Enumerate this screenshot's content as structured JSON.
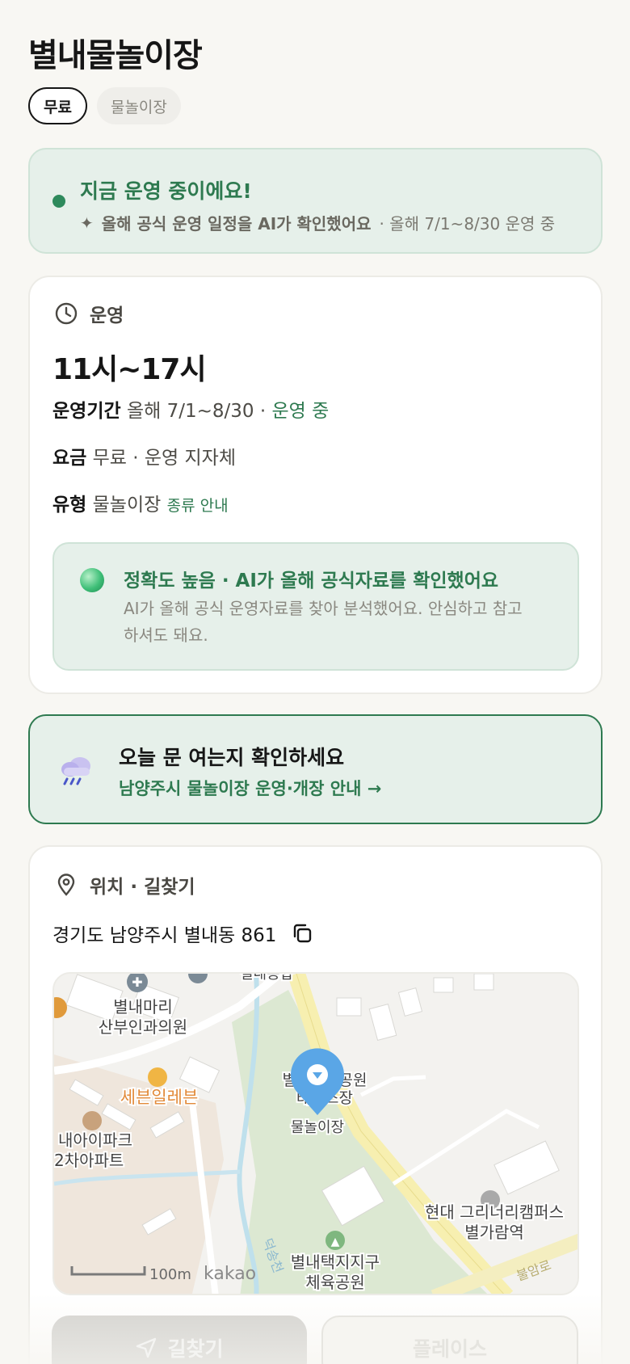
{
  "page": {
    "title": "별내물놀이장",
    "chips": [
      "무료",
      "물놀이장"
    ]
  },
  "status": {
    "title": "지금 운영 중이에요!",
    "sub_bold": "올해 공식 운영 일정을 AI가 확인했어요",
    "sub_rest": "· 올해 7/1~8/30 운영 중",
    "icon": "sparkle-icon"
  },
  "operation": {
    "heading": "운영",
    "hours": "11시~17시",
    "period_label": "운영기간",
    "period_value": "올해 7/1~8/30 ·",
    "period_status": "운영 중",
    "fee_label": "요금",
    "fee_value": "무료 · 운영 지자체",
    "type_label": "유형",
    "type_value": "물놀이장",
    "type_link": "종류 안내",
    "accuracy_title": "정확도 높음 · AI가 올해 공식자료를 확인했어요",
    "accuracy_desc": "AI가 올해 공식 운영자료를 찾아 분석했어요. 안심하고 참고하셔도 돼요."
  },
  "notice": {
    "title": "오늘 문 여는지 확인하세요",
    "link": "남양주시 물놀이장 운영·개장 안내 →",
    "icon": "rain-cloud-icon"
  },
  "location": {
    "heading": "위치 · 길찾기",
    "address": "경기도 남양주시 별내동 861",
    "map": {
      "labels": {
        "clinic": "별내마리\n산부인과의원",
        "store": "세븐일레븐",
        "apartment": "내아이파크\n2차아파트",
        "park": "별내근린공원\n테니스장",
        "pin": "물놀이장",
        "campus": "현대 그리너리캠퍼스\n별가람역",
        "sports": "별내택지지구\n체육공원",
        "stream": "덕송천",
        "road": "불암로",
        "top": "별내종합"
      },
      "scale": "100m",
      "brand": "kakao"
    }
  },
  "actions": {
    "directions": "길찾기",
    "place": "플레이스"
  },
  "colors": {
    "accent": "#2e7a50",
    "background": "#f8f7f3",
    "status_bg": "#e6f0ea"
  }
}
